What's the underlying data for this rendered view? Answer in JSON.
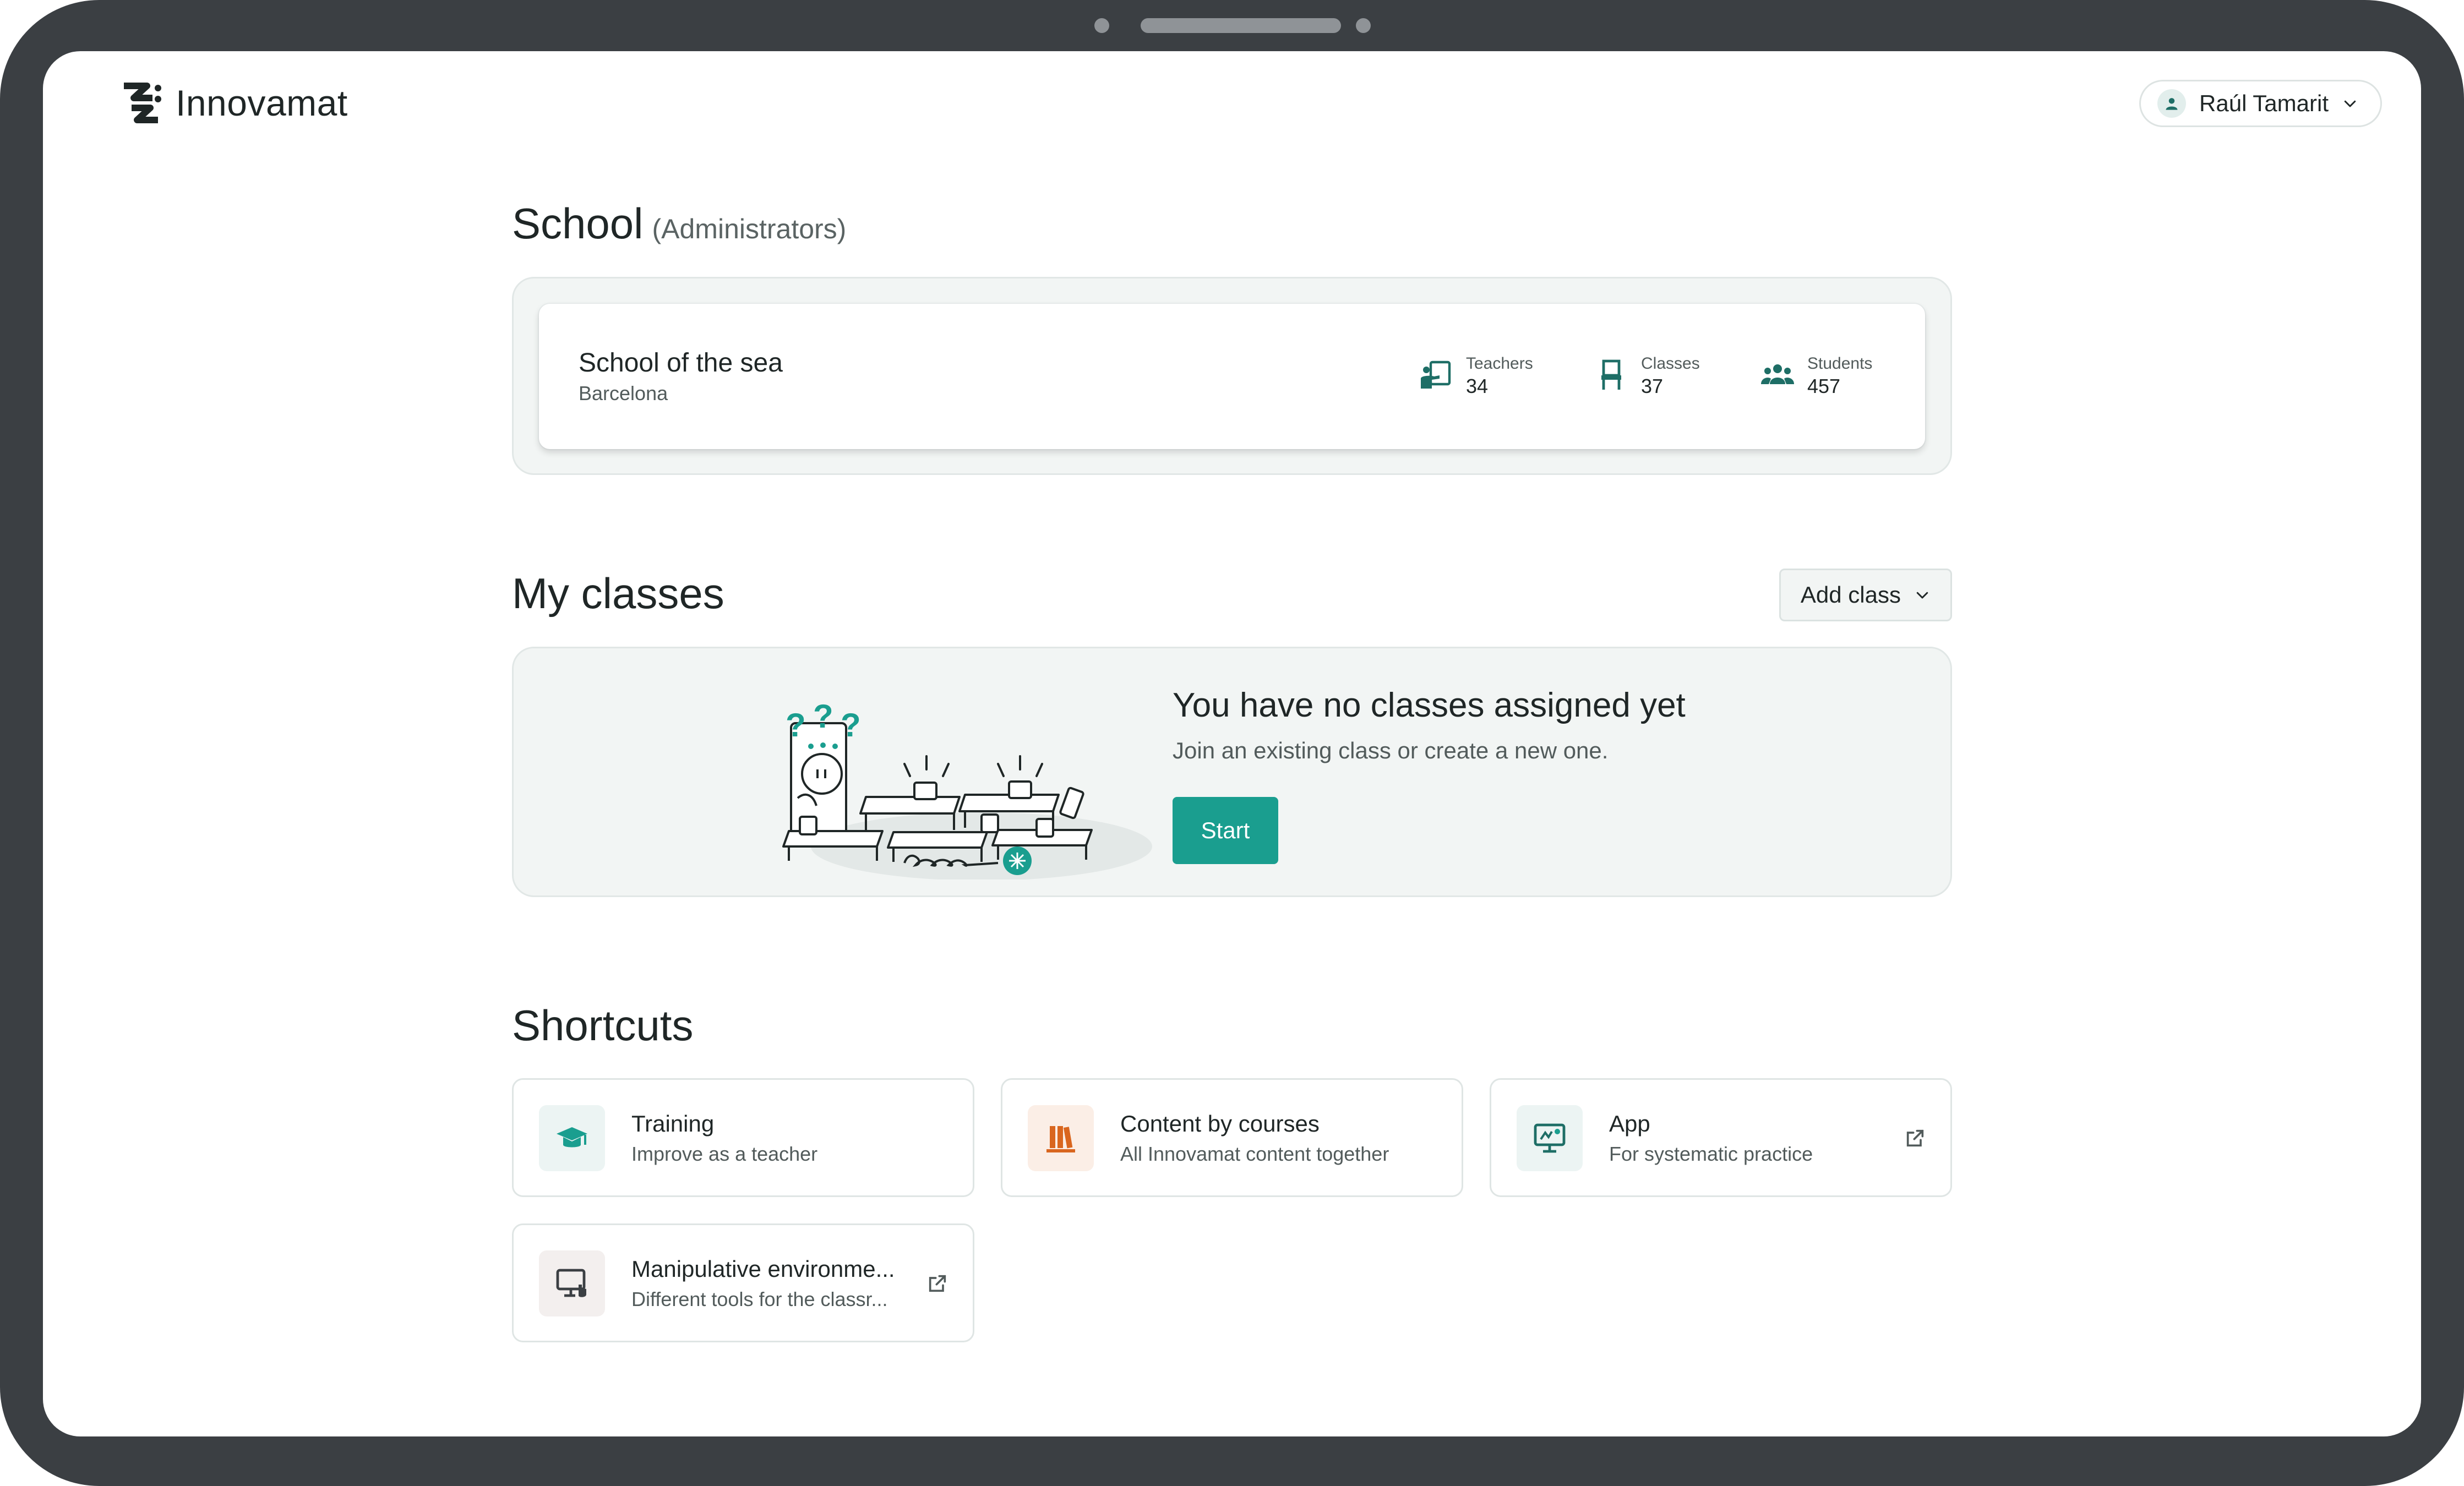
{
  "header": {
    "brand": "Innovamat",
    "user_name": "Raúl Tamarit"
  },
  "school_section": {
    "title": "School",
    "subtitle": "(Administrators)",
    "school_name": "School of the sea",
    "city": "Barcelona",
    "stats": [
      {
        "label": "Teachers",
        "value": "34",
        "icon": "teacher-icon"
      },
      {
        "label": "Classes",
        "value": "37",
        "icon": "chair-icon"
      },
      {
        "label": "Students",
        "value": "457",
        "icon": "students-icon"
      }
    ]
  },
  "classes_section": {
    "title": "My classes",
    "add_class_label": "Add class",
    "empty_title": "You have no classes assigned yet",
    "empty_subtitle": "Join an existing class or create a new one.",
    "start_label": "Start"
  },
  "shortcuts_section": {
    "title": "Shortcuts",
    "items": [
      {
        "title": "Training",
        "subtitle": "Improve as a teacher",
        "icon": "graduation-cap-icon",
        "external": false
      },
      {
        "title": "Content by courses",
        "subtitle": "All Innovamat content together",
        "icon": "books-icon",
        "external": false
      },
      {
        "title": "App",
        "subtitle": "For systematic practice",
        "icon": "monitor-app-icon",
        "external": true
      },
      {
        "title": "Manipulative environme...",
        "subtitle": "Different tools for the classr...",
        "icon": "monitor-touch-icon",
        "external": true
      }
    ]
  },
  "colors": {
    "accent": "#1a9e8f",
    "accent_dark": "#1e6e66",
    "orange": "#d9661f",
    "frame": "#3b3f43"
  }
}
